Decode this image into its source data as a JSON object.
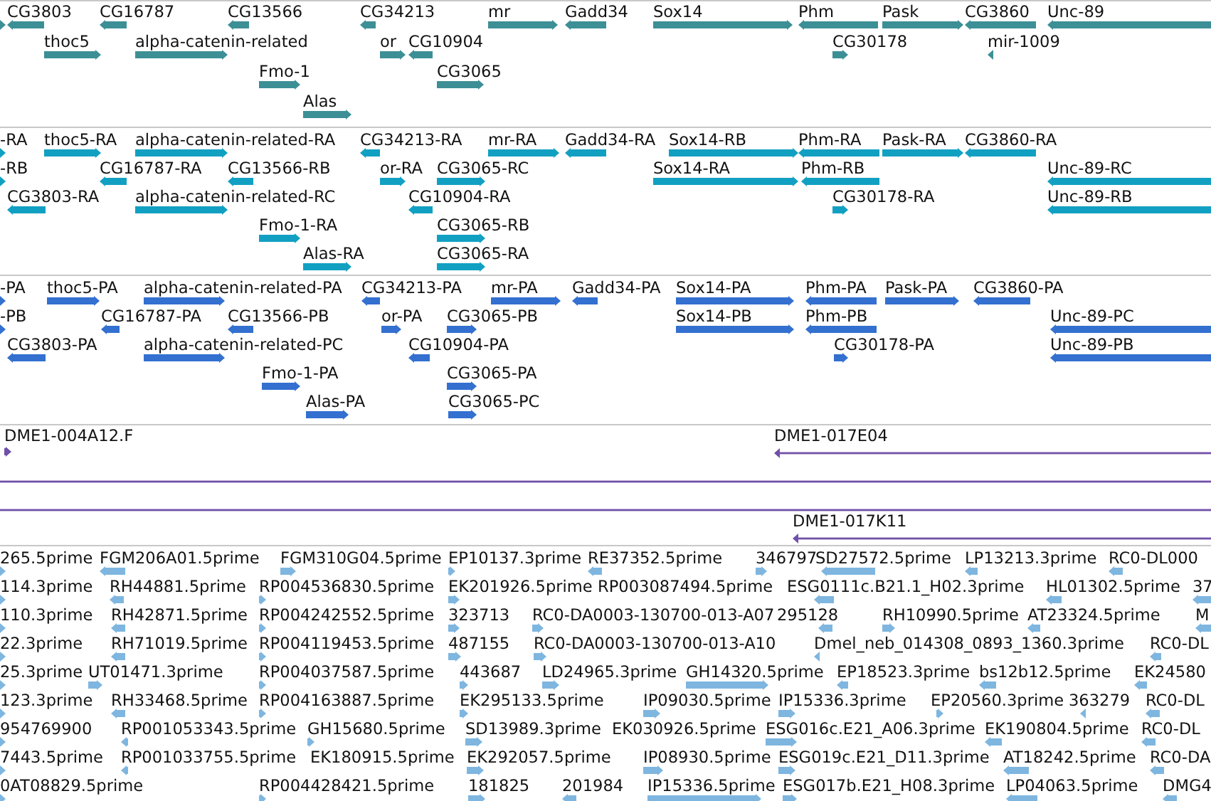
{
  "tracks": [
    {
      "kind": "features",
      "color": "#3d8f96",
      "lanes": [
        {
          "features": [
            {
              "reverse": false
            },
            {
              "label": "CG3803",
              "reverse": true
            },
            {
              "label": "CG16787",
              "reverse": true
            },
            {
              "label": "CG13566",
              "reverse": true
            },
            {
              "label": "CG34213",
              "reverse": true
            },
            {
              "label": "mr",
              "reverse": false
            },
            {
              "label": "Gadd34",
              "reverse": true
            },
            {
              "label": "Sox14",
              "reverse": false
            },
            {
              "label": "Phm",
              "reverse": true
            },
            {
              "label": "Pask",
              "reverse": false
            },
            {
              "label": "CG3860",
              "reverse": true
            },
            {
              "label": "Unc-89",
              "reverse": true
            }
          ]
        },
        {
          "features": [
            {
              "label": "thoc5",
              "reverse": false
            },
            {
              "label": "alpha-catenin-related",
              "reverse": false
            },
            {
              "label": "or",
              "reverse": false
            },
            {
              "label": "CG10904",
              "reverse": true
            },
            {
              "label": "CG30178",
              "reverse": false
            },
            {
              "label": "mir-1009",
              "reverse": true
            }
          ]
        },
        {
          "features": [
            {
              "label": "Fmo-1",
              "reverse": false
            },
            {
              "label": "CG3065",
              "reverse": false
            }
          ]
        },
        {
          "features": [
            {
              "label": "Alas",
              "reverse": false
            }
          ]
        }
      ]
    },
    {
      "kind": "features",
      "color": "#12a0c2",
      "lanes": [
        {
          "features": [
            {
              "label": "-RA",
              "reverse": false
            },
            {
              "label": "thoc5-RA",
              "reverse": false
            },
            {
              "label": "alpha-catenin-related-RA",
              "reverse": false
            },
            {
              "label": "CG34213-RA",
              "reverse": true
            },
            {
              "label": "mr-RA",
              "reverse": false
            },
            {
              "label": "Gadd34-RA",
              "reverse": true
            },
            {
              "label": "Sox14-RB",
              "reverse": false
            },
            {
              "label": "Phm-RA",
              "reverse": true
            },
            {
              "label": "Pask-RA",
              "reverse": false
            },
            {
              "label": "CG3860-RA",
              "reverse": true
            }
          ]
        },
        {
          "features": [
            {
              "label": "-RB",
              "reverse": false
            },
            {
              "label": "CG16787-RA",
              "reverse": true
            },
            {
              "label": "CG13566-RB",
              "reverse": true
            },
            {
              "label": "or-RA",
              "reverse": false
            },
            {
              "label": "CG3065-RC",
              "reverse": false
            },
            {
              "label": "Sox14-RA",
              "reverse": false
            },
            {
              "label": "Phm-RB",
              "reverse": true
            },
            {
              "label": "Unc-89-RC",
              "reverse": true
            }
          ]
        },
        {
          "features": [
            {
              "label": "CG3803-RA",
              "reverse": true
            },
            {
              "label": "alpha-catenin-related-RC",
              "reverse": false
            },
            {
              "label": "CG10904-RA",
              "reverse": true
            },
            {
              "label": "CG30178-RA",
              "reverse": false
            },
            {
              "label": "Unc-89-RB",
              "reverse": true
            }
          ]
        },
        {
          "features": [
            {
              "label": "Fmo-1-RA",
              "reverse": false
            },
            {
              "label": "CG3065-RB",
              "reverse": false
            }
          ]
        },
        {
          "features": [
            {
              "label": "Alas-RA",
              "reverse": false
            },
            {
              "label": "CG3065-RA",
              "reverse": false
            }
          ]
        }
      ]
    },
    {
      "kind": "features",
      "color": "#3370d0",
      "lanes": [
        {
          "features": [
            {
              "label": "-PA",
              "reverse": false
            },
            {
              "label": "thoc5-PA",
              "reverse": false
            },
            {
              "label": "alpha-catenin-related-PA",
              "reverse": false
            },
            {
              "label": "CG34213-PA",
              "reverse": true
            },
            {
              "label": "mr-PA",
              "reverse": false
            },
            {
              "label": "Gadd34-PA",
              "reverse": true
            },
            {
              "label": "Sox14-PA",
              "reverse": false
            },
            {
              "label": "Phm-PA",
              "reverse": true
            },
            {
              "label": "Pask-PA",
              "reverse": false
            },
            {
              "label": "CG3860-PA",
              "reverse": true
            }
          ]
        },
        {
          "features": [
            {
              "label": "-PB",
              "reverse": false
            },
            {
              "label": "CG16787-PA",
              "reverse": true
            },
            {
              "label": "CG13566-PB",
              "reverse": true
            },
            {
              "label": "or-PA",
              "reverse": false
            },
            {
              "label": "CG3065-PB",
              "reverse": false
            },
            {
              "label": "Sox14-PB",
              "reverse": false
            },
            {
              "label": "Phm-PB",
              "reverse": true
            },
            {
              "label": "Unc-89-PC",
              "reverse": true
            }
          ]
        },
        {
          "features": [
            {
              "label": "CG3803-PA",
              "reverse": true
            },
            {
              "label": "alpha-catenin-related-PC",
              "reverse": false
            },
            {
              "label": "CG10904-PA",
              "reverse": true
            },
            {
              "label": "CG30178-PA",
              "reverse": false
            },
            {
              "label": "Unc-89-PB",
              "reverse": true
            }
          ]
        },
        {
          "features": [
            {
              "label": "Fmo-1-PA",
              "reverse": false
            },
            {
              "label": "CG3065-PA",
              "reverse": false
            }
          ]
        },
        {
          "features": [
            {
              "label": "Alas-PA",
              "reverse": false
            },
            {
              "label": "CG3065-PC",
              "reverse": false
            }
          ]
        }
      ]
    },
    {
      "kind": "clones",
      "color": "#7050a8",
      "items": [
        {
          "kind": "clone",
          "label": "DME1-004A12.F",
          "reverse": false
        },
        {
          "kind": "clone",
          "label": "DME1-017E04",
          "reverse": true
        },
        {
          "kind": "span"
        },
        {
          "kind": "span"
        },
        {
          "kind": "clone",
          "label": "DME1-017K11",
          "reverse": true
        }
      ]
    },
    {
      "kind": "features",
      "color": "#7eb6e0",
      "lanes": [
        {
          "features": [
            {
              "label": "265.5prime",
              "reverse": false
            },
            {
              "label": "FGM206A01.5prime",
              "reverse": true
            },
            {
              "label": "FGM310G04.5prime",
              "reverse": false
            },
            {
              "label": "EP10137.3prime",
              "reverse": false
            },
            {
              "label": "RE37352.5prime",
              "reverse": true
            },
            {
              "label": "346797",
              "reverse": false
            },
            {
              "label": "SD27572.5prime",
              "reverse": true
            },
            {
              "label": "LP13213.3prime",
              "reverse": true
            },
            {
              "label": "RC0-DL000",
              "reverse": true
            }
          ]
        },
        {
          "features": [
            {
              "label": "114.3prime",
              "reverse": false
            },
            {
              "label": "RH44881.5prime",
              "reverse": true
            },
            {
              "label": "RP004536830.5prime",
              "reverse": false
            },
            {
              "label": "EK201926.5prime",
              "reverse": false
            },
            {
              "label": "RP003087494.5prime"
            },
            {
              "label": "ESG0111c.B21.1_H02.3prime",
              "reverse": true
            },
            {
              "label": "HL01302.5prime",
              "reverse": true
            },
            {
              "label": "37",
              "reverse": true
            }
          ]
        },
        {
          "features": [
            {
              "label": "110.3prime",
              "reverse": false
            },
            {
              "label": "RH42871.5prime",
              "reverse": true
            },
            {
              "label": "RP004242552.5prime",
              "reverse": false
            },
            {
              "label": "323713",
              "reverse": false
            },
            {
              "label": "RC0-DA0003-130700-013-A07",
              "reverse": false
            },
            {
              "label": "295128",
              "reverse": true
            },
            {
              "label": "RH10990.5prime",
              "reverse": false
            },
            {
              "label": "AT23324.5prime",
              "reverse": true
            },
            {
              "label": "M",
              "reverse": true
            }
          ]
        },
        {
          "features": [
            {
              "label": "22.3prime",
              "reverse": false
            },
            {
              "label": "RH71019.5prime",
              "reverse": true
            },
            {
              "label": "RP004119453.5prime",
              "reverse": false
            },
            {
              "label": "487155",
              "reverse": false
            },
            {
              "label": "RC0-DA0003-130700-013-A10",
              "reverse": false
            },
            {
              "label": "Dmel_neb_014308_0893_1360.3prime",
              "reverse": true
            },
            {
              "label": "RC0-DL",
              "reverse": true
            }
          ]
        },
        {
          "features": [
            {
              "label": "25.3prime",
              "reverse": false
            },
            {
              "label": "UT01471.3prime",
              "reverse": false
            },
            {
              "label": "RP004037587.5prime",
              "reverse": false
            },
            {
              "label": "443687",
              "reverse": false
            },
            {
              "label": "LD24965.3prime",
              "reverse": false
            },
            {
              "label": "GH14320.5prime",
              "reverse": false
            },
            {
              "label": "EP18523.3prime",
              "reverse": true
            },
            {
              "label": "bs12b12.5prime",
              "reverse": true
            },
            {
              "label": "EK24580",
              "reverse": true
            }
          ]
        },
        {
          "features": [
            {
              "label": "123.3prime",
              "reverse": false
            },
            {
              "label": "RH33468.5prime",
              "reverse": true
            },
            {
              "label": "RP004163887.5prime",
              "reverse": false
            },
            {
              "label": "EK295133.5prime",
              "reverse": false
            },
            {
              "label": "IP09030.5prime",
              "reverse": false
            },
            {
              "label": "IP15336.3prime",
              "reverse": false
            },
            {
              "label": "EP20560.3prime",
              "reverse": false
            },
            {
              "label": "363279",
              "reverse": true
            },
            {
              "label": "RC0-DL",
              "reverse": true
            }
          ]
        },
        {
          "features": [
            {
              "label": "954769900",
              "reverse": false
            },
            {
              "label": "RP001053343.5prime",
              "reverse": true
            },
            {
              "label": "GH15680.5prime",
              "reverse": false
            },
            {
              "label": "SD13989.3prime",
              "reverse": false
            },
            {
              "label": "EK030926.5prime"
            },
            {
              "label": "ESG016c.E21_A06.3prime",
              "reverse": false
            },
            {
              "label": "EK190804.5prime",
              "reverse": true
            },
            {
              "label": "RC0-DL",
              "reverse": true
            }
          ]
        },
        {
          "features": [
            {
              "label": "7443.5prime",
              "reverse": false
            },
            {
              "label": "RP001033755.5prime",
              "reverse": true
            },
            {
              "label": "EK180915.5prime"
            },
            {
              "label": "EK292057.5prime",
              "reverse": false
            },
            {
              "label": "IP08930.5prime",
              "reverse": false
            },
            {
              "label": "ESG019c.E21_D11.3prime",
              "reverse": false
            },
            {
              "label": "AT18242.5prime",
              "reverse": true
            },
            {
              "label": "RC0-DA",
              "reverse": true
            }
          ]
        },
        {
          "features": [
            {
              "label": "0AT08829.5prime",
              "reverse": false
            },
            {
              "label": "RP004428421.5prime",
              "reverse": false
            },
            {
              "label": "181825",
              "reverse": false
            },
            {
              "label": "201984",
              "reverse": true
            },
            {
              "label": "IP15336.5prime",
              "reverse": false
            },
            {
              "label": "ESG017b.E21_H08.3prime",
              "reverse": false
            },
            {
              "label": "LP04063.5prime",
              "reverse": true
            },
            {
              "label": "DMG4",
              "reverse": true
            }
          ]
        }
      ]
    }
  ]
}
